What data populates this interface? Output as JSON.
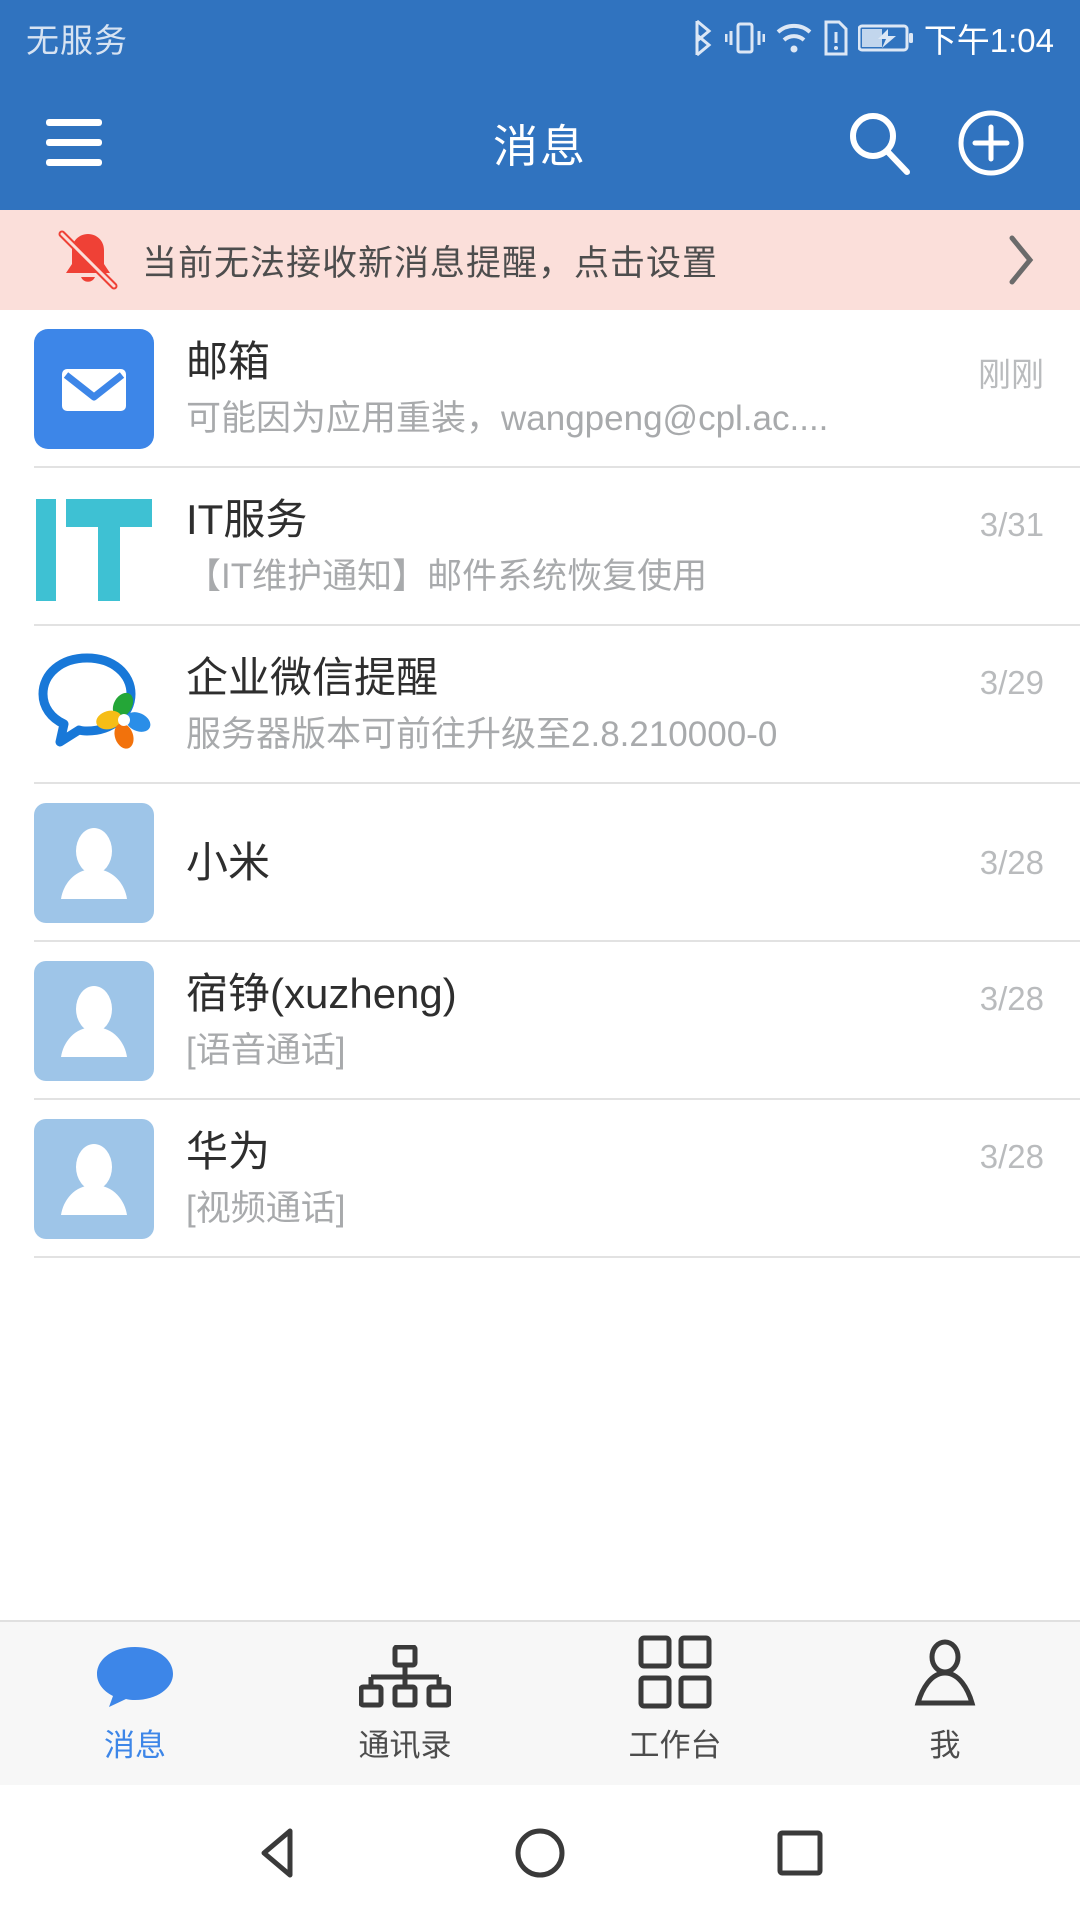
{
  "colors": {
    "brand_blue": "#3073bf",
    "accent_blue": "#3d86e8",
    "banner_bg": "#fbdfda",
    "banner_icon": "#ef4136",
    "it_teal": "#3ec1d3",
    "avatar_blue": "#9ec5e8",
    "tab_active": "#3d86e8"
  },
  "statusbar": {
    "carrier": "无服务",
    "clock": "下午1:04",
    "icons": [
      "bluetooth-icon",
      "vibrate-icon",
      "wifi-icon",
      "sim-alert-icon",
      "battery-charging-icon"
    ]
  },
  "appbar": {
    "title": "消息",
    "menu_icon": "hamburger-menu-icon",
    "search_icon": "search-icon",
    "add_icon": "plus-circle-icon"
  },
  "banner": {
    "icon": "bell-off-icon",
    "text": "当前无法接收新消息提醒，点击设置",
    "chevron": "chevron-right-icon"
  },
  "conversations": [
    {
      "icon": "mail-envelope-icon",
      "avatar_type": "mail",
      "title": "邮箱",
      "subtitle": "可能因为应用重装，wangpeng@cpl.ac....",
      "time": "刚刚"
    },
    {
      "icon": "it-service-logo",
      "avatar_type": "plain",
      "title": "IT服务",
      "subtitle": "【IT维护通知】邮件系统恢复使用",
      "time": "3/31"
    },
    {
      "icon": "wecom-logo-icon",
      "avatar_type": "plain",
      "title": "企业微信提醒",
      "subtitle": "服务器版本可前往升级至2.8.210000-0",
      "time": "3/29"
    },
    {
      "icon": "person-placeholder-icon",
      "avatar_type": "person",
      "title": "小米",
      "subtitle": "",
      "time": "3/28"
    },
    {
      "icon": "person-placeholder-icon",
      "avatar_type": "person",
      "title": "宿铮(xuzheng)",
      "subtitle": "[语音通话]",
      "time": "3/28"
    },
    {
      "icon": "person-placeholder-icon",
      "avatar_type": "person",
      "title": "华为",
      "subtitle": "[视频通话]",
      "time": "3/28"
    }
  ],
  "tabbar": {
    "items": [
      {
        "label": "消息",
        "icon": "chat-bubble-icon",
        "active": true
      },
      {
        "label": "通讯录",
        "icon": "org-tree-icon",
        "active": false
      },
      {
        "label": "工作台",
        "icon": "grid-squares-icon",
        "active": false
      },
      {
        "label": "我",
        "icon": "person-outline-icon",
        "active": false
      }
    ]
  },
  "navbar": {
    "back": "back-triangle-icon",
    "home": "home-circle-icon",
    "recents": "recents-square-icon"
  }
}
